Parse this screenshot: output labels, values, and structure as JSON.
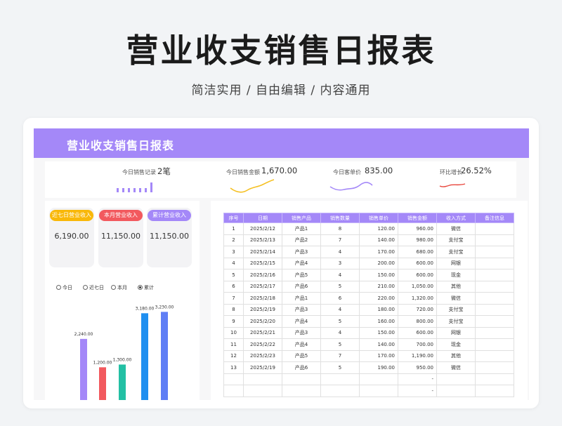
{
  "page": {
    "title": "营业收支销售日报表",
    "subtitle": "简洁实用 / 自由编辑 / 内容通用"
  },
  "sheet": {
    "title": "营业收支销售日报表",
    "kpis": [
      {
        "label": "今日销售记录",
        "value": "2笔",
        "chart": "bars",
        "color": "#a488f8"
      },
      {
        "label": "今日销售金额",
        "value": "1,670.00",
        "chart": "line",
        "color": "#f5c022"
      },
      {
        "label": "今日客单价",
        "value": "835.00",
        "chart": "line",
        "color": "#a488f8"
      },
      {
        "label": "环比增长",
        "value": "26.52%",
        "chart": "line",
        "color": "#e8463c"
      }
    ],
    "stats": [
      {
        "label": "近七日营业收入",
        "value": "6,190.00",
        "color": "#f9b809"
      },
      {
        "label": "本月营业收入",
        "value": "11,150.00",
        "color": "#f2595e"
      },
      {
        "label": "累计营业收入",
        "value": "11,150.00",
        "color": "#a488f8"
      }
    ],
    "period_options": [
      {
        "label": "今日",
        "selected": false
      },
      {
        "label": "近七日",
        "selected": false
      },
      {
        "label": "本月",
        "selected": false
      },
      {
        "label": "累计",
        "selected": true
      }
    ],
    "table": {
      "headers": [
        "序号",
        "日期",
        "销售产品",
        "销售数量",
        "销售单价",
        "销售金额",
        "收入方式",
        "备注信息"
      ],
      "rows": [
        [
          "1",
          "2025/2/12",
          "产品1",
          "8",
          "120.00",
          "960.00",
          "微信",
          ""
        ],
        [
          "2",
          "2025/2/13",
          "产品2",
          "7",
          "140.00",
          "980.00",
          "支付宝",
          ""
        ],
        [
          "3",
          "2025/2/14",
          "产品3",
          "4",
          "170.00",
          "680.00",
          "支付宝",
          ""
        ],
        [
          "4",
          "2025/2/15",
          "产品4",
          "3",
          "200.00",
          "600.00",
          "网银",
          ""
        ],
        [
          "5",
          "2025/2/16",
          "产品5",
          "4",
          "150.00",
          "600.00",
          "现金",
          ""
        ],
        [
          "6",
          "2025/2/17",
          "产品6",
          "5",
          "210.00",
          "1,050.00",
          "其他",
          ""
        ],
        [
          "7",
          "2025/2/18",
          "产品1",
          "6",
          "220.00",
          "1,320.00",
          "微信",
          ""
        ],
        [
          "8",
          "2025/2/19",
          "产品3",
          "4",
          "180.00",
          "720.00",
          "支付宝",
          ""
        ],
        [
          "9",
          "2025/2/20",
          "产品4",
          "5",
          "160.00",
          "800.00",
          "支付宝",
          ""
        ],
        [
          "10",
          "2025/2/21",
          "产品3",
          "4",
          "150.00",
          "600.00",
          "网银",
          ""
        ],
        [
          "11",
          "2025/2/22",
          "产品4",
          "5",
          "140.00",
          "700.00",
          "现金",
          ""
        ],
        [
          "12",
          "2025/2/23",
          "产品5",
          "7",
          "170.00",
          "1,190.00",
          "其他",
          ""
        ],
        [
          "13",
          "2025/2/19",
          "产品6",
          "5",
          "190.00",
          "950.00",
          "微信",
          ""
        ],
        [
          "",
          "",
          "",
          "",
          "",
          "-",
          "",
          ""
        ],
        [
          "",
          "",
          "",
          "",
          "",
          "-",
          "",
          ""
        ]
      ]
    }
  },
  "chart_data": {
    "type": "bar",
    "categories": [
      "今日",
      "近七日",
      "本月",
      "累计",
      "",
      "",
      ""
    ],
    "values": [
      2240,
      1200,
      1300,
      3180,
      3230
    ],
    "value_labels": [
      "2,240.00",
      "1,200.00",
      "1,300.00",
      "3,180.00",
      "3,230.00"
    ],
    "colors": [
      "#a488f8",
      "#f2595e",
      "#23c0a4",
      "#1f8ff0",
      "#5f7ef5"
    ],
    "ylim": [
      0,
      3600
    ]
  }
}
